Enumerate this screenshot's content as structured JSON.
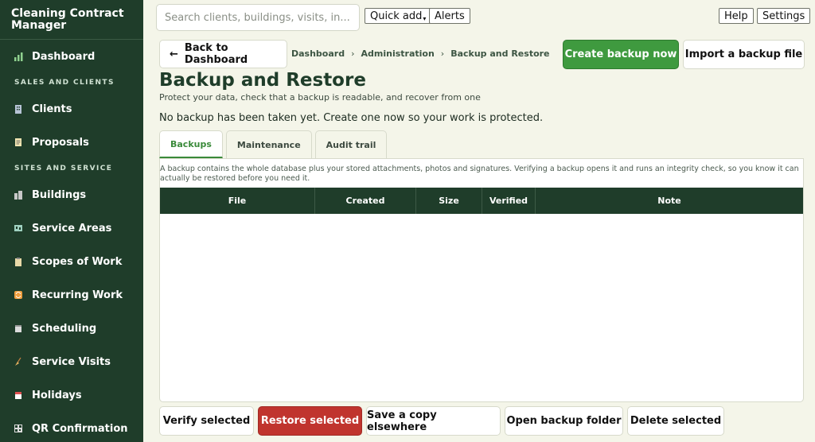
{
  "app": {
    "title": "Cleaning Contract Manager"
  },
  "sidebar": {
    "items": [
      {
        "type": "item",
        "label": "Dashboard",
        "icon": "bar-chart-icon",
        "color": "#8fd18f"
      },
      {
        "type": "section",
        "label": "SALES AND CLIENTS"
      },
      {
        "type": "item",
        "label": "Clients",
        "icon": "office-building-icon",
        "color": "#b7c4d6"
      },
      {
        "type": "item",
        "label": "Proposals",
        "icon": "memo-icon",
        "color": "#f2e6b3"
      },
      {
        "type": "section",
        "label": "SITES AND SERVICE"
      },
      {
        "type": "item",
        "label": "Buildings",
        "icon": "buildings-icon",
        "color": "#c8c8c8"
      },
      {
        "type": "item",
        "label": "Service Areas",
        "icon": "world-map-icon",
        "color": "#9fd1c0"
      },
      {
        "type": "item",
        "label": "Scopes of Work",
        "icon": "clipboard-icon",
        "color": "#e8d9a8"
      },
      {
        "type": "item",
        "label": "Recurring Work",
        "icon": "repeat-icon",
        "color": "#f0a040"
      },
      {
        "type": "item",
        "label": "Scheduling",
        "icon": "calendar-icon",
        "color": "#dcdcdc"
      },
      {
        "type": "item",
        "label": "Service Visits",
        "icon": "broom-icon",
        "color": "#e0b060"
      },
      {
        "type": "item",
        "label": "Holidays",
        "icon": "calendar-date-icon",
        "color": "#e05050"
      },
      {
        "type": "item",
        "label": "QR Confirmation",
        "icon": "qr-code-icon",
        "color": "#dcdcdc"
      }
    ]
  },
  "topbar": {
    "search_placeholder": "Search clients, buildings, visits, in...",
    "quick_add": "Quick add",
    "alerts": "Alerts",
    "help": "Help",
    "settings": "Settings"
  },
  "header": {
    "back": "Back to Dashboard",
    "breadcrumb": [
      "Dashboard",
      "Administration",
      "Backup and Restore"
    ],
    "create_backup": "Create backup now",
    "import_backup": "Import a backup file",
    "title": "Backup and Restore",
    "subtitle": "Protect your data, check that a backup is readable, and recover from one",
    "status": "No backup has been taken yet. Create one now so your work is protected."
  },
  "tabs": [
    "Backups",
    "Maintenance",
    "Audit trail"
  ],
  "panel": {
    "note": "A backup contains the whole database plus your stored attachments, photos and signatures. Verifying a backup opens it and runs an integrity check, so you know it can actually be restored before you need it.",
    "columns": [
      "File",
      "Created",
      "Size",
      "Verified",
      "Note"
    ]
  },
  "actions": {
    "verify": "Verify selected",
    "restore": "Restore selected",
    "save_copy": "Save a copy elsewhere",
    "open_folder": "Open backup folder",
    "delete": "Delete selected"
  },
  "colors": {
    "sidebar": "#1f3d2a",
    "primary": "#3f9a3f",
    "danger": "#c0342e",
    "background": "#f4f5e9"
  }
}
